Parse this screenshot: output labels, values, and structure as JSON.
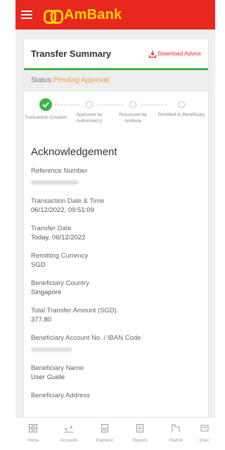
{
  "header": {
    "brand": "AmBank",
    "colors": {
      "bar": "#e8281f",
      "logo": "#ffd200"
    }
  },
  "summary": {
    "title": "Transfer Summary",
    "download_label": "Download Advice",
    "status_label": "Status:",
    "status_value": "Pending Approval",
    "status_color": "#f0a030"
  },
  "steps": [
    {
      "label": "Transaction Creation",
      "state": "done"
    },
    {
      "label": "Approved by Authoriser(s)",
      "state": "pending"
    },
    {
      "label": "Processed by AmBank",
      "state": "pending"
    },
    {
      "label": "Remitted to Beneficiary",
      "state": "pending"
    }
  ],
  "acknowledgement": {
    "title": "Acknowledgement",
    "fields": [
      {
        "label": "Reference Number",
        "value": "",
        "redacted": true
      },
      {
        "label": "Transaction Date & Time",
        "value": "06/12/2022, 09:51:09"
      },
      {
        "label": "Transfer Date",
        "value": "Today, 06/12/2022"
      },
      {
        "label": "Remitting Currency",
        "value": "SGD"
      },
      {
        "label": "Beneficiary Country",
        "value": "Singapore"
      },
      {
        "label": "Total Transfer Amount (SGD)",
        "value": "377.80"
      },
      {
        "label": "Beneficiary Account No. / IBAN Code",
        "value": "",
        "redacted": true
      },
      {
        "label": "Beneficiary Name",
        "value": "User Guide"
      },
      {
        "label": "Beneficiary Address",
        "value": ""
      }
    ]
  },
  "nav": [
    {
      "label": "Home",
      "icon": "home-icon"
    },
    {
      "label": "Accounts",
      "icon": "accounts-icon"
    },
    {
      "label": "Payment",
      "icon": "payment-icon"
    },
    {
      "label": "Reports",
      "icon": "reports-icon"
    },
    {
      "label": "Payroll",
      "icon": "payroll-icon"
    },
    {
      "label": "Chec",
      "icon": "cheque-icon"
    }
  ]
}
